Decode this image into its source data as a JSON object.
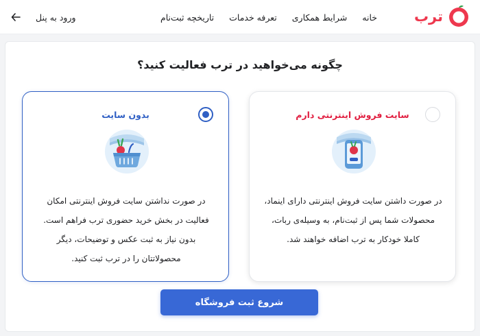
{
  "header": {
    "logo_text": "ترب",
    "nav": [
      "خانه",
      "شرایط همکاری",
      "تعرفه خدمات",
      "تاریخچه ثبت‌نام"
    ],
    "login_label": "ورود به پنل"
  },
  "main": {
    "title": "چگونه می‌خواهید در ترب فعالیت کنید؟",
    "cards": [
      {
        "title": "بدون سایت",
        "selected": true,
        "icon": "shopping-basket-icon",
        "desc": [
          "در صورت نداشتن سایت فروش اینترنتی امکان",
          "فعالیت در بخش خرید حضوری ترب فراهم است.",
          "بدون نیاز به ثبت عکس و توضیحات، دیگر",
          "محصولاتتان را در ترب ثبت کنید."
        ]
      },
      {
        "title": "سایت فروش اینترنتی دارم",
        "selected": false,
        "icon": "online-store-icon",
        "desc": [
          "در صورت داشتن سایت فروش اینترنتی دارای اینماد،",
          "محصولات شما پس از ثبت‌نام، به وسیله‌ی ربات،",
          "کاملا خودکار به ترب اضافه خواهند شد."
        ]
      }
    ],
    "cta_label": "شروع ثبت فروشگاه"
  },
  "colors": {
    "brand": "#ee384e",
    "primary": "#3868d6",
    "selected_border": "#2f5fc4"
  }
}
